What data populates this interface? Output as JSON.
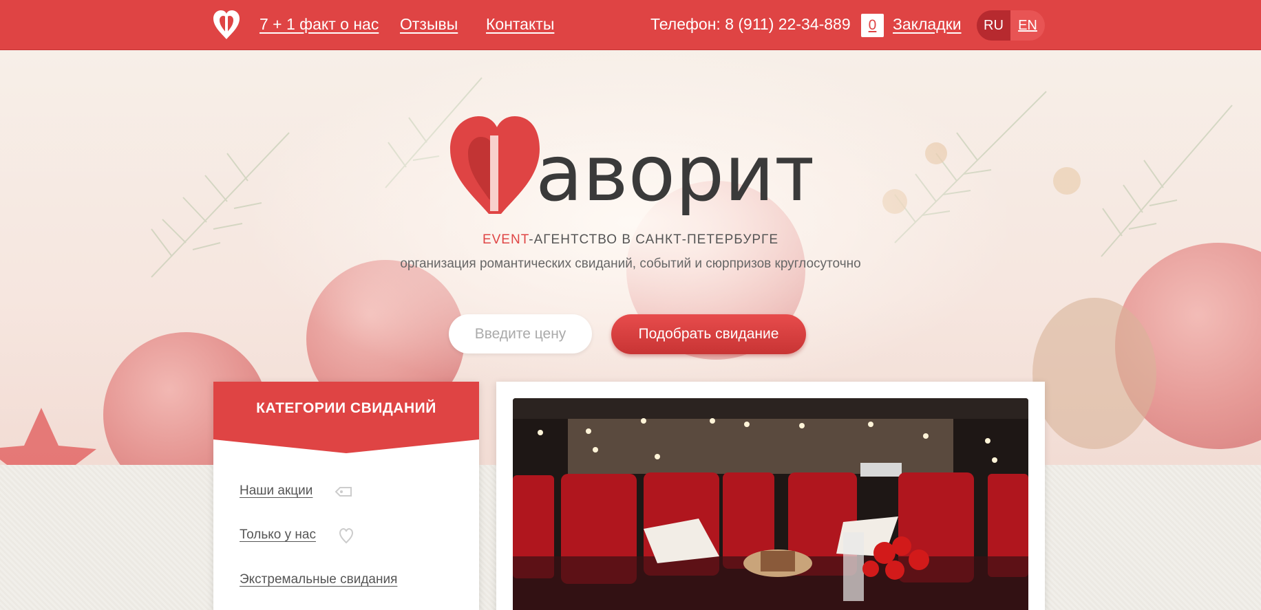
{
  "nav": {
    "facts": "7 + 1 факт о нас",
    "reviews": "Отзывы",
    "contacts": "Контакты",
    "phone": "Телефон: 8 (911) 22-34-889",
    "bookmarks_count": "0",
    "bookmarks": "Закладки",
    "lang_ru": "RU",
    "lang_en": "EN"
  },
  "hero": {
    "logo_text": "аворит",
    "tagline_accent": "EVENT",
    "tagline_rest": "-АГЕНТСТВО В САНКТ-ПЕТЕРБУРГЕ",
    "subline": "организация романтических свиданий, событий и сюрпризов круглосуточно",
    "price_placeholder": "Введите цену",
    "pick_button": "Подобрать свидание"
  },
  "categories": {
    "title": "КАТЕГОРИИ СВИДАНИЙ",
    "items": [
      {
        "label": "Наши акции",
        "icon": "tag-icon"
      },
      {
        "label": "Только у нас",
        "icon": "heart-outline-icon"
      },
      {
        "label": "Экстремальные свидания",
        "icon": ""
      }
    ]
  },
  "colors": {
    "brand": "#df4444",
    "brand_dark": "#b72a2f",
    "text": "#555555"
  }
}
